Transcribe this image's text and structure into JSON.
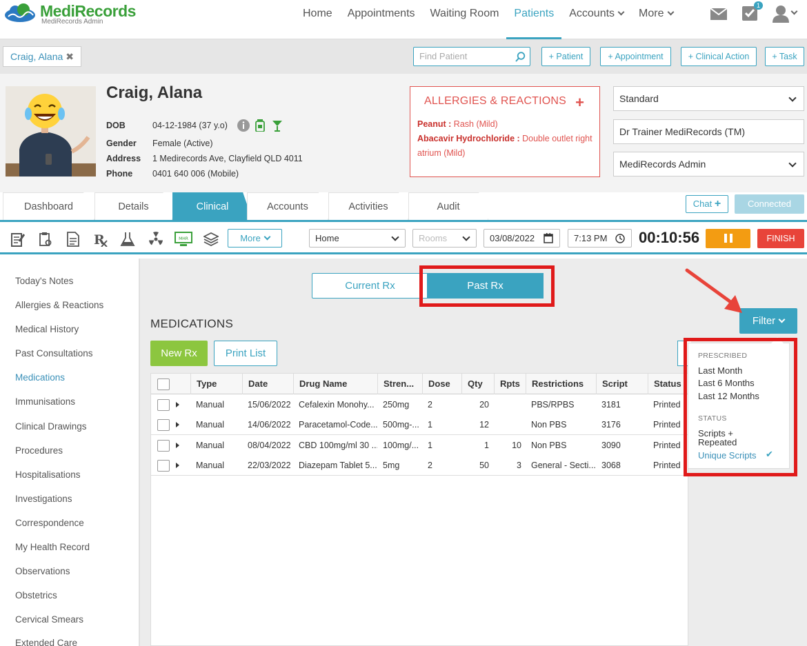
{
  "brand": {
    "name_a": "Medi",
    "name_b": "Records",
    "subtitle": "MediRecords Admin"
  },
  "nav": {
    "items": [
      "Home",
      "Appointments",
      "Waiting Room",
      "Patients",
      "Accounts",
      "More"
    ],
    "active": "Patients",
    "task_badge": "1"
  },
  "patient_bar": {
    "open_patient": "Craig, Alana",
    "find_placeholder": "Find Patient",
    "actions": [
      "+ Patient",
      "+ Appointment",
      "+ Clinical Action",
      "+ Task"
    ]
  },
  "patient": {
    "name": "Craig, Alana",
    "dob_label": "DOB",
    "dob": "04-12-1984 (37 y.o)",
    "gender_label": "Gender",
    "gender": "Female (Active)",
    "address_label": "Address",
    "address": "1 Medirecords Ave, Clayfield QLD 4011",
    "phone_label": "Phone",
    "phone": "0401 640 006 (Mobile)"
  },
  "allergies": {
    "title": "ALLERGIES & REACTIONS",
    "items": [
      {
        "name": "Peanut",
        "reaction": "Rash (Mild)"
      },
      {
        "name": "Abacavir Hydrochloride",
        "reaction": "Double outlet right atrium (Mild)"
      }
    ]
  },
  "right_selects": {
    "mode": "Standard",
    "doctor": "Dr Trainer MediRecords (TM)",
    "practice": "MediRecords Admin"
  },
  "tabs": [
    "Dashboard",
    "Details",
    "Clinical",
    "Accounts",
    "Activities",
    "Audit"
  ],
  "active_tab": "Clinical",
  "chat": {
    "label": "Chat",
    "status": "Connected"
  },
  "toolbar": {
    "more_label": "More",
    "location": "Home",
    "rooms_placeholder": "Rooms",
    "date": "03/08/2022",
    "time": "7:13 PM",
    "timer": "00:10:56",
    "finish": "FINISH",
    "icons": [
      "notes-icon",
      "clipboard-icon",
      "document-icon",
      "rx-icon",
      "lab-icon",
      "radiation-icon",
      "mhr-icon",
      "stack-icon"
    ],
    "mhr_text": "MHR"
  },
  "sidebar": [
    "Today's Notes",
    "Allergies & Reactions",
    "Medical History",
    "Past Consultations",
    "Medications",
    "Immunisations",
    "Clinical Drawings",
    "Procedures",
    "Hospitalisations",
    "Investigations",
    "Correspondence",
    "My Health Record",
    "Observations",
    "Obstetrics",
    "Cervical Smears",
    "Extended Care"
  ],
  "sidebar_active": "Medications",
  "rx_toggle": {
    "current": "Current Rx",
    "past": "Past Rx",
    "active": "past"
  },
  "medications": {
    "title": "MEDICATIONS",
    "new_rx": "New Rx",
    "print_list": "Print List",
    "filter": "Filter",
    "columns": [
      "Type",
      "Date",
      "Drug Name",
      "Stren...",
      "Dose",
      "Qty",
      "Rpts",
      "Restrictions",
      "Script",
      "Status"
    ],
    "rows": [
      {
        "type": "Manual",
        "date": "15/06/2022",
        "drug": "Cefalexin Monohy...",
        "strength": "250mg",
        "dose": "2",
        "qty": "20",
        "rpts": "",
        "restrictions": "PBS/RPBS",
        "script": "3181",
        "status": "Printed"
      },
      {
        "type": "Manual",
        "date": "14/06/2022",
        "drug": "Paracetamol-Code...",
        "strength": "500mg-...",
        "dose": "1",
        "qty": "12",
        "rpts": "",
        "restrictions": "Non PBS",
        "script": "3176",
        "status": "Printed"
      },
      {
        "type": "Manual",
        "date": "08/04/2022",
        "drug": "CBD 100mg/ml 30 ...",
        "strength": "100mg/...",
        "dose": "1",
        "qty": "1",
        "rpts": "10",
        "restrictions": "Non PBS",
        "script": "3090",
        "status": "Printed"
      },
      {
        "type": "Manual",
        "date": "22/03/2022",
        "drug": "Diazepam Tablet 5...",
        "strength": "5mg",
        "dose": "2",
        "qty": "50",
        "rpts": "3",
        "restrictions": "General - Secti...",
        "script": "3068",
        "status": "Printed"
      }
    ]
  },
  "filter_menu": {
    "prescribed_label": "PRESCRIBED",
    "prescribed": [
      "Last Month",
      "Last 6 Months",
      "Last 12 Months"
    ],
    "status_label": "STATUS",
    "status_a_line1": "Scripts +",
    "status_a_line2": "Repeated",
    "status_b": "Unique Scripts",
    "selected": "Unique Scripts"
  },
  "colors": {
    "accent": "#3aa3c0",
    "allergy": "#e0534f",
    "green": "#8cc63f",
    "pause": "#f39c12",
    "finish": "#e8443a",
    "annotation": "#e01a1a"
  }
}
